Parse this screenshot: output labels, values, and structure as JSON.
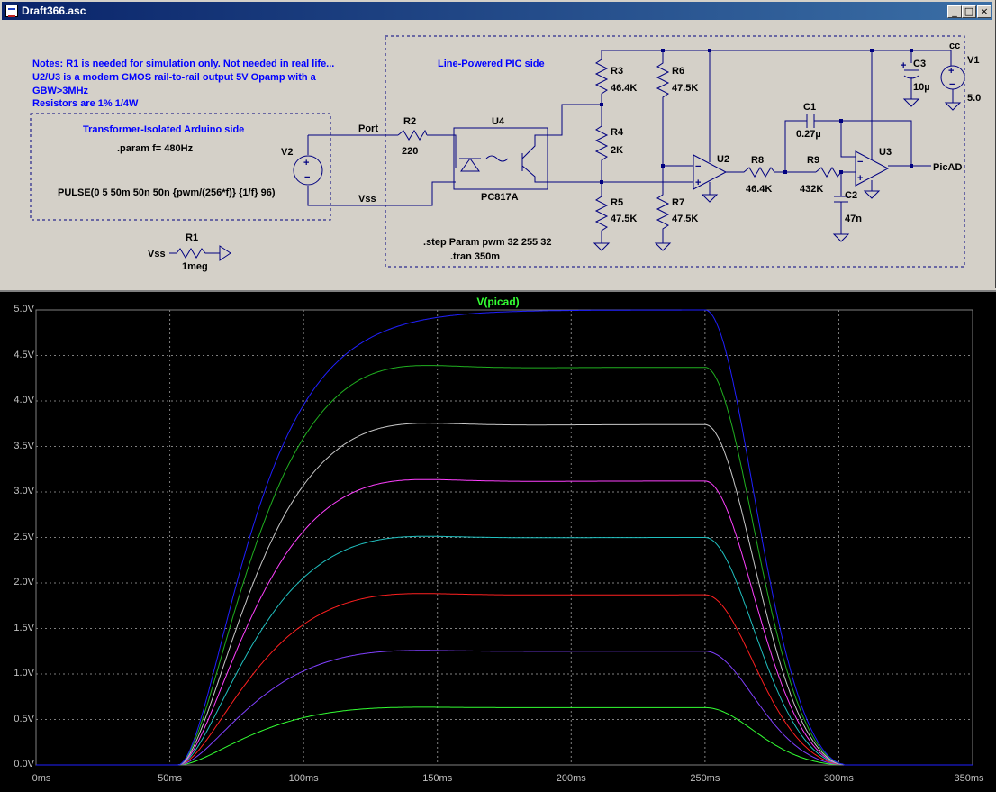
{
  "window": {
    "title": "Draft366.asc",
    "buttons": {
      "minimize": "_",
      "maximize": "□",
      "close": "×"
    }
  },
  "schematic": {
    "notes": [
      "Notes: R1 is needed for simulation only. Not needed in real life...",
      "U2/U3 is a modern CMOS rail-to-rail output 5V Opamp with a",
      "GBW>3MHz",
      "Resistors are 1% 1/4W"
    ],
    "arduino_side_label": "Transformer-Isolated Arduino side",
    "param_directive": ".param f= 480Hz",
    "pulse_directive": "PULSE(0 5 50m 50n 50n {pwm/(256*f)} {1/f} 96)",
    "pic_side_label": "Line-Powered PIC side",
    "step_directive": ".step Param pwm 32 255 32",
    "tran_directive": ".tran 350m",
    "nets": {
      "port": "Port",
      "vss": "Vss",
      "vcc": "cc",
      "picad": "PicAD"
    },
    "components": {
      "V1": {
        "ref": "V1",
        "value": "5.0"
      },
      "V2": {
        "ref": "V2"
      },
      "R1": {
        "ref": "R1",
        "value": "1meg"
      },
      "R2": {
        "ref": "R2",
        "value": "220"
      },
      "R3": {
        "ref": "R3",
        "value": "46.4K"
      },
      "R4": {
        "ref": "R4",
        "value": "2K"
      },
      "R5": {
        "ref": "R5",
        "value": "47.5K"
      },
      "R6": {
        "ref": "R6",
        "value": "47.5K"
      },
      "R7": {
        "ref": "R7",
        "value": "47.5K"
      },
      "R8": {
        "ref": "R8",
        "value": "46.4K"
      },
      "R9": {
        "ref": "R9",
        "value": "432K"
      },
      "C1": {
        "ref": "C1",
        "value": "0.27µ"
      },
      "C2": {
        "ref": "C2",
        "value": "47n"
      },
      "C3": {
        "ref": "C3",
        "value": "10µ"
      },
      "U2": {
        "ref": "U2"
      },
      "U3": {
        "ref": "U3"
      },
      "U4": {
        "ref": "U4",
        "value": "PC817A"
      }
    }
  },
  "plot": {
    "title": "V(picad)",
    "title_color": "#33ff33"
  },
  "chart_data": {
    "type": "line",
    "title": "V(picad)",
    "xlabel": "",
    "ylabel": "",
    "xlim": [
      0,
      350
    ],
    "ylim": [
      0,
      5
    ],
    "grid": true,
    "x_ticks": [
      "0ms",
      "50ms",
      "100ms",
      "150ms",
      "200ms",
      "250ms",
      "300ms",
      "350ms"
    ],
    "y_ticks": [
      "0.0V",
      "0.5V",
      "1.0V",
      "1.5V",
      "2.0V",
      "2.5V",
      "3.0V",
      "3.5V",
      "4.0V",
      "4.5V",
      "5.0V"
    ],
    "x_units": "ms",
    "series": [
      {
        "color": "#33ff33",
        "peak": 0.66,
        "steady": 0.63
      },
      {
        "color": "#8040ff",
        "peak": 1.31,
        "steady": 1.25
      },
      {
        "color": "#ff2020",
        "peak": 1.96,
        "steady": 1.87
      },
      {
        "color": "#20c0c0",
        "peak": 2.61,
        "steady": 2.5
      },
      {
        "color": "#ff40ff",
        "peak": 3.26,
        "steady": 3.12
      },
      {
        "color": "#c8c8c8",
        "peak": 3.9,
        "steady": 3.74
      },
      {
        "color": "#20b020",
        "peak": 4.56,
        "steady": 4.37
      },
      {
        "color": "#2020ff",
        "peak": 5.0,
        "steady": 5.0
      }
    ],
    "rise_start_ms": 53,
    "fall_start_ms": 250,
    "fall_end_ms": 302
  }
}
